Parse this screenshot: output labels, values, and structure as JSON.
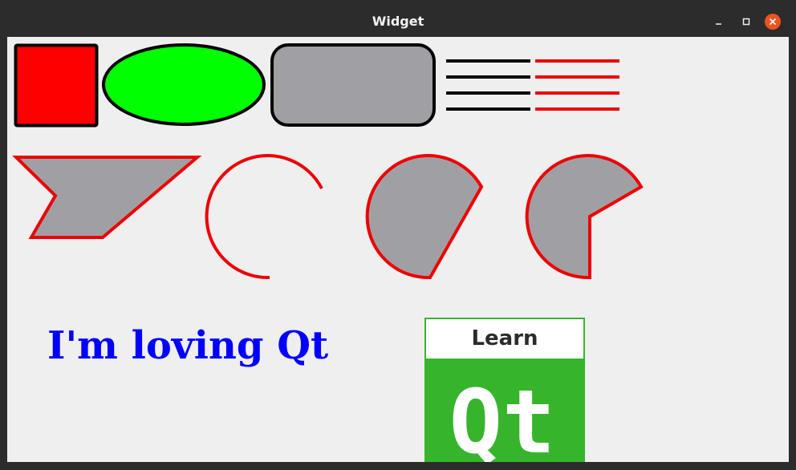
{
  "window": {
    "title": "Widget",
    "controls": [
      "minimize-icon",
      "maximize-icon",
      "close-icon"
    ]
  },
  "canvas": {
    "text": "I'm loving Qt",
    "text_color": "#0000ff",
    "logo": {
      "top_text": "Learn",
      "main_text": "Qt",
      "green": "#36b52c",
      "border_green": "#36b52c"
    },
    "colors": {
      "red": "#ff0000",
      "green": "#00ff00",
      "gray": "#a0a0a4",
      "black": "#000000",
      "stroke_red": "#ee0000"
    }
  }
}
